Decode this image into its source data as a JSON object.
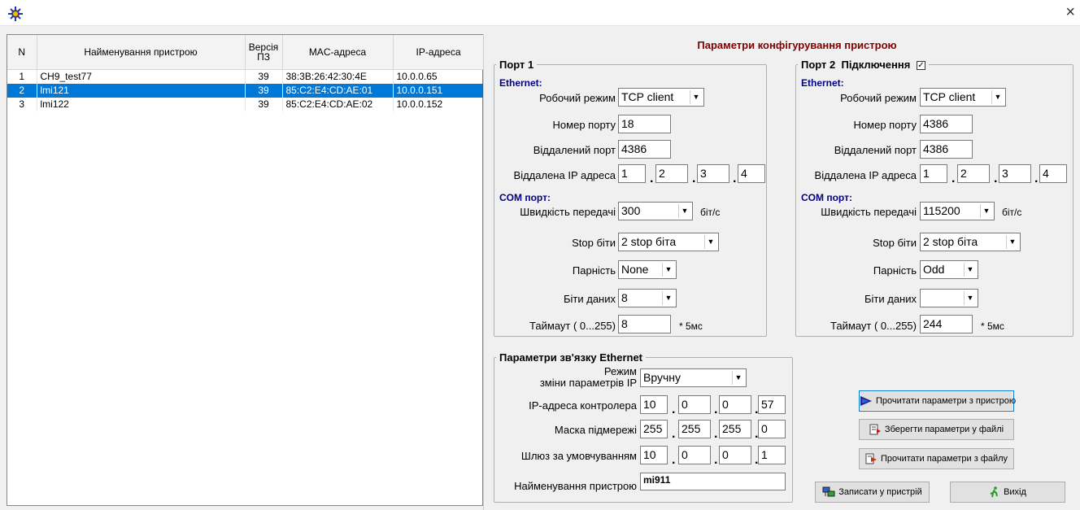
{
  "window": {
    "close_glyph": "×",
    "icon": "gear-app-icon"
  },
  "table": {
    "headers": {
      "n": "N",
      "name": "Найменування пристрою",
      "version": "Версія ПЗ",
      "mac": "MAC-адреса",
      "ip": "IP-адреса"
    },
    "rows": [
      {
        "n": "1",
        "name": "CH9_test77",
        "version": "39",
        "mac": "38:3B:26:42:30:4E",
        "ip": "10.0.0.65",
        "selected": false
      },
      {
        "n": "2",
        "name": "lmi121",
        "version": "39",
        "mac": "85:C2:E4:CD:AE:01",
        "ip": "10.0.0.151",
        "selected": true
      },
      {
        "n": "3",
        "name": "lmi122",
        "version": "39",
        "mac": "85:C2:E4:CD:AE:02",
        "ip": "10.0.0.152",
        "selected": false
      }
    ],
    "selection_color": "#0078d7"
  },
  "config_title": "Параметри конфігурування пристрою",
  "labels": {
    "ethernet": "Ethernet:",
    "com_port": "COM порт:",
    "work_mode": "Робочий режим",
    "port_number": "Номер порту",
    "remote_port": "Віддалений порт",
    "remote_ip": "Віддалена IP адреса",
    "baud_rate": "Швидкість передачі",
    "baud_unit": "біт/с",
    "stop_bits": "Stop біти",
    "parity": "Парність",
    "data_bits": "Біти даних",
    "timeout": "Таймаут  ( 0...255)",
    "timeout_unit": "* 5мс"
  },
  "port1": {
    "legend": "Порт 1",
    "work_mode": "TCP client",
    "port_number": "18",
    "remote_port": "4386",
    "remote_ip": [
      "1",
      "2",
      "3",
      "4"
    ],
    "baud_rate": "300",
    "stop_bits": "2      stop біта",
    "parity": "None",
    "data_bits": "8",
    "timeout": "8"
  },
  "port2": {
    "legend": "Порт 2",
    "connection_label": "Підключення",
    "connection_checked": "✓",
    "work_mode": "TCP client",
    "port_number": "4386",
    "remote_port": "4386",
    "remote_ip": [
      "1",
      "2",
      "3",
      "4"
    ],
    "baud_rate": "115200",
    "stop_bits": "2      stop біта",
    "parity": "Odd",
    "data_bits": "",
    "timeout": "244"
  },
  "ethernet_params": {
    "legend": "Параметри зв'язку Ethernet",
    "mode_label_line1": "Режим",
    "mode_label_line2": "зміни параметрів IP",
    "mode_value": "Вручну",
    "ip_label": "IP-адреса контролера",
    "ip": [
      "10",
      "0",
      "0",
      "57"
    ],
    "mask_label": "Маска підмережі",
    "mask": [
      "255",
      "255",
      "255",
      "0"
    ],
    "gateway_label": "Шлюз за умовчуванням",
    "gateway": [
      "10",
      "0",
      "0",
      "1"
    ],
    "name_label": "Найменування пристрою",
    "name_value": "mi911"
  },
  "buttons": {
    "read_device": "Прочитати параметри з пристрою",
    "save_file": "Зберегти параметри у файлі",
    "read_file": "Прочитати параметри з файлу",
    "write_device": "Записати у пристрій",
    "exit": "Вихід"
  }
}
